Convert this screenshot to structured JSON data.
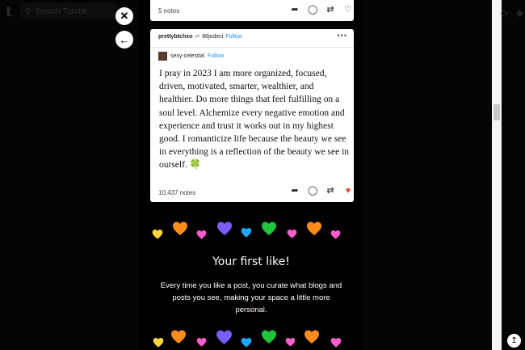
{
  "app": {
    "logo": "t",
    "search_placeholder": "Search Tumblr"
  },
  "overlay": {
    "close_icon": "✕",
    "back_icon": "←"
  },
  "top_post": {
    "notes": "5 notes"
  },
  "post": {
    "reblogger": "prettybtchxo",
    "reblog_icon": "⇄",
    "reblogged_from": "86jodeci",
    "follow_label": "Follow",
    "more_label": "•••",
    "source_blog": "sexy-celestial",
    "source_follow_label": "Follow",
    "text": "I pray in 2023 I am more organized, focused, driven, motivated, smarter, wealthier, and healthier. Do more things that feel fulfilling on a soul level. Alchemize every negative emotion and experience and trust it works out in my highest good. I romanticize life because the beauty we see in everything is a reflection of the beauty we see in ourself.",
    "emoji": "🍀",
    "notes": "10,437 notes",
    "liked": true
  },
  "promo": {
    "title": "Your first like!",
    "text": "Every time you like a post, you curate what blogs and posts you see, making your space a little more personal.",
    "heart_colors": [
      "#ffd53d",
      "#ff8c1a",
      "#ff5ccc",
      "#7a5cff",
      "#1ea7ff",
      "#1fc43a",
      "#ff5ccc",
      "#ff8c1a",
      "#ff5ccc"
    ]
  },
  "scroll_top_icon": "↥"
}
